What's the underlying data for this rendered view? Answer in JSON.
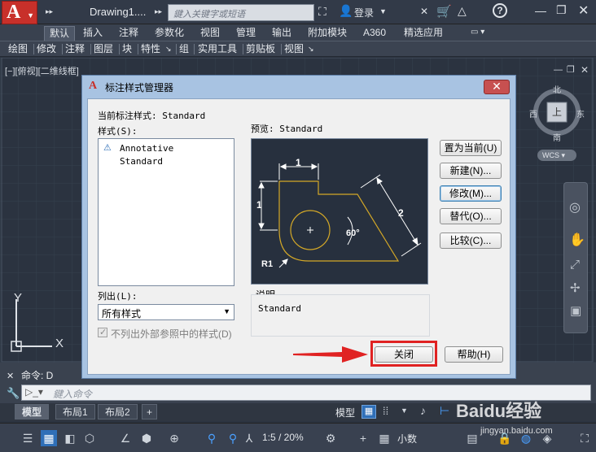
{
  "titlebar": {
    "doc_title": "Drawing1....",
    "search_placeholder": "鍵入关键字或短语",
    "login_label": "登录",
    "nav_arrows": "▸▸"
  },
  "ribbon": {
    "tabs": [
      "默认",
      "插入",
      "注释",
      "参数化",
      "视图",
      "管理",
      "输出",
      "附加模块",
      "A360",
      "精选应用"
    ],
    "active_tab": "默认",
    "panels": [
      "绘图",
      "修改",
      "注释",
      "图层",
      "块",
      "特性",
      "组",
      "实用工具",
      "剪贴板",
      "视图"
    ]
  },
  "viewport": {
    "label": "[−][俯视][二维线框]",
    "viewcube_top": "上",
    "viewcube_north": "北",
    "viewcube_south": "南",
    "viewcube_east": "东",
    "viewcube_west": "西",
    "wcs_label": "WCS",
    "ucs_x": "X",
    "ucs_y": "Y"
  },
  "dialog": {
    "title": "标注样式管理器",
    "current_style_label": "当前标注样式: Standard",
    "styles_label": "样式(S):",
    "styles": [
      "Annotative",
      "Standard"
    ],
    "preview_label": "预览: Standard",
    "list_label": "列出(L):",
    "list_value": "所有样式",
    "exclude_xref_label": "不列出外部参照中的样式(D)",
    "description_label": "说明",
    "description_value": "Standard",
    "buttons": {
      "set_current": "置为当前(U)",
      "new": "新建(N)...",
      "modify": "修改(M)...",
      "override": "替代(O)...",
      "compare": "比较(C)...",
      "close": "关闭",
      "help": "帮助(H)"
    },
    "preview_dims": {
      "top": "1",
      "left": "1",
      "slant": "2",
      "angle": "60°",
      "radius": "R1"
    }
  },
  "command": {
    "history": "命令: D",
    "input_placeholder": "鍵入命令"
  },
  "layout_tabs": [
    "模型",
    "布局1",
    "布局2"
  ],
  "layout_active": "模型",
  "statusbar": {
    "model_label": "模型",
    "scale": "1:5 / 20%",
    "units": "小数"
  },
  "watermark": {
    "text": "Baidu经验",
    "url": "jingyan.baidu.com"
  },
  "colors": {
    "accent_red": "#e02222",
    "preview_dim": "#d4a827",
    "preview_dim_lines": "#ffffff"
  }
}
